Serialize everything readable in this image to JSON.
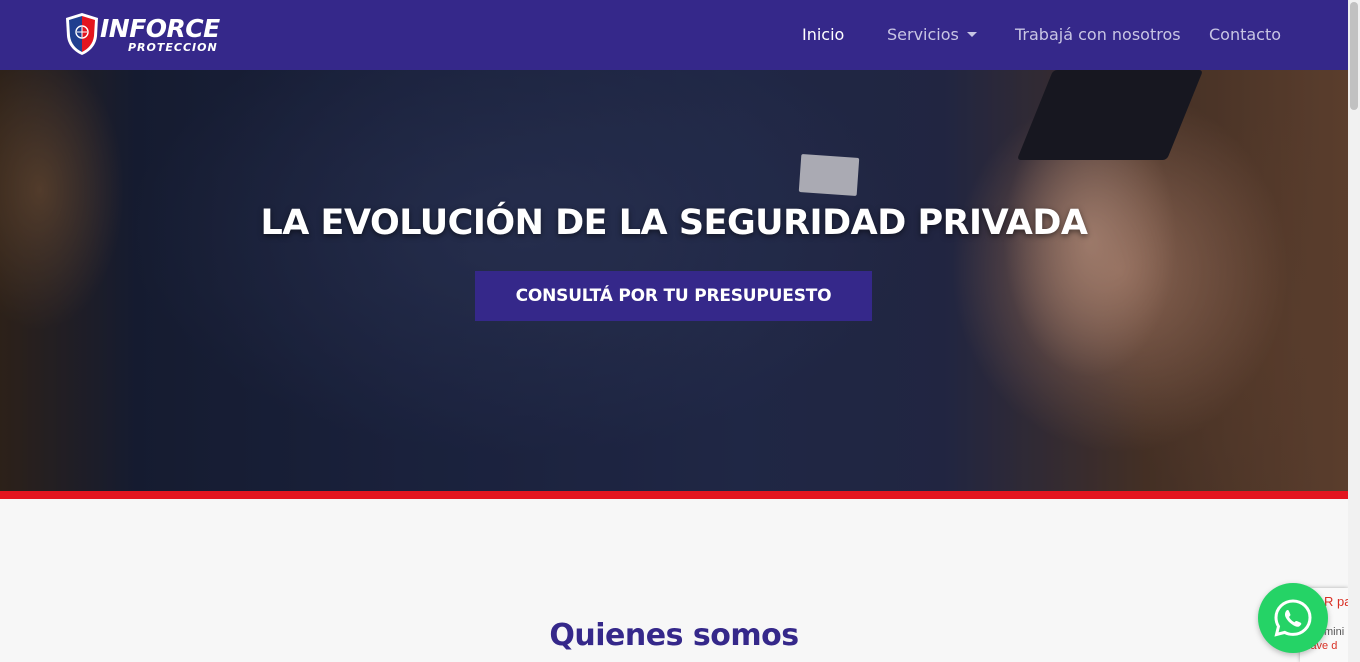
{
  "brand": {
    "name": "INFORCE",
    "subtitle": "PROTECCION",
    "logo_icon": "shield-logo-icon"
  },
  "nav": {
    "items": [
      {
        "label": "Inicio",
        "active": true
      },
      {
        "label": "Servicios",
        "dropdown": true
      },
      {
        "label": "Trabajá con nosotros"
      },
      {
        "label": "Contacto"
      }
    ]
  },
  "hero": {
    "title": "LA EVOLUCIÓN DE LA SEGURIDAD PRIVADA",
    "cta_label": "CONSULTÁ POR TU PRESUPUESTO"
  },
  "about": {
    "title": "Quienes somos"
  },
  "recaptcha": {
    "line1": "R pa",
    "line2": "mini",
    "line3": "lave d"
  },
  "whatsapp": {
    "icon": "whatsapp-icon"
  },
  "colors": {
    "primary": "#35288a",
    "accent_red": "#e3151f",
    "whatsapp_green": "#25d366"
  }
}
